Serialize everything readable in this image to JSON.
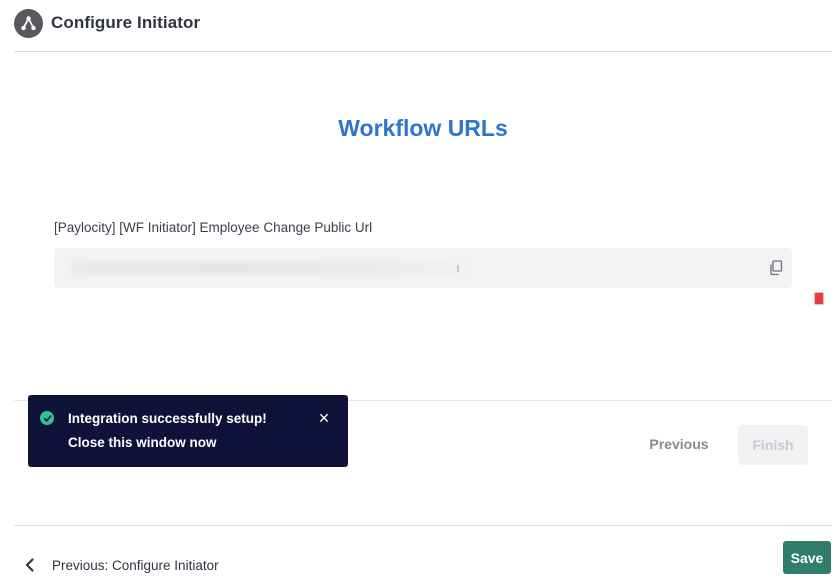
{
  "header": {
    "title": "Configure Initiator",
    "icon": "workflow-icon"
  },
  "main": {
    "title": "Workflow URLs",
    "url_field": {
      "label": "[Paylocity] [WF Initiator] Employee Change Public Url",
      "value_state": "blurred",
      "copy_icon": "copy-icon"
    }
  },
  "toast": {
    "line1": "Integration successfully setup!",
    "line2": "Close this window now",
    "status_icon": "check-circle-icon",
    "close_glyph": "✕",
    "status_color": "#31c48d",
    "background": "#0f1238"
  },
  "actions": {
    "previous_label": "Previous",
    "finish_label": "Finish"
  },
  "footer": {
    "back_label": "Previous: Configure Initiator",
    "save_label": "Save"
  },
  "colors": {
    "accent": "#2f74d0",
    "save": "#2e7d6d"
  }
}
